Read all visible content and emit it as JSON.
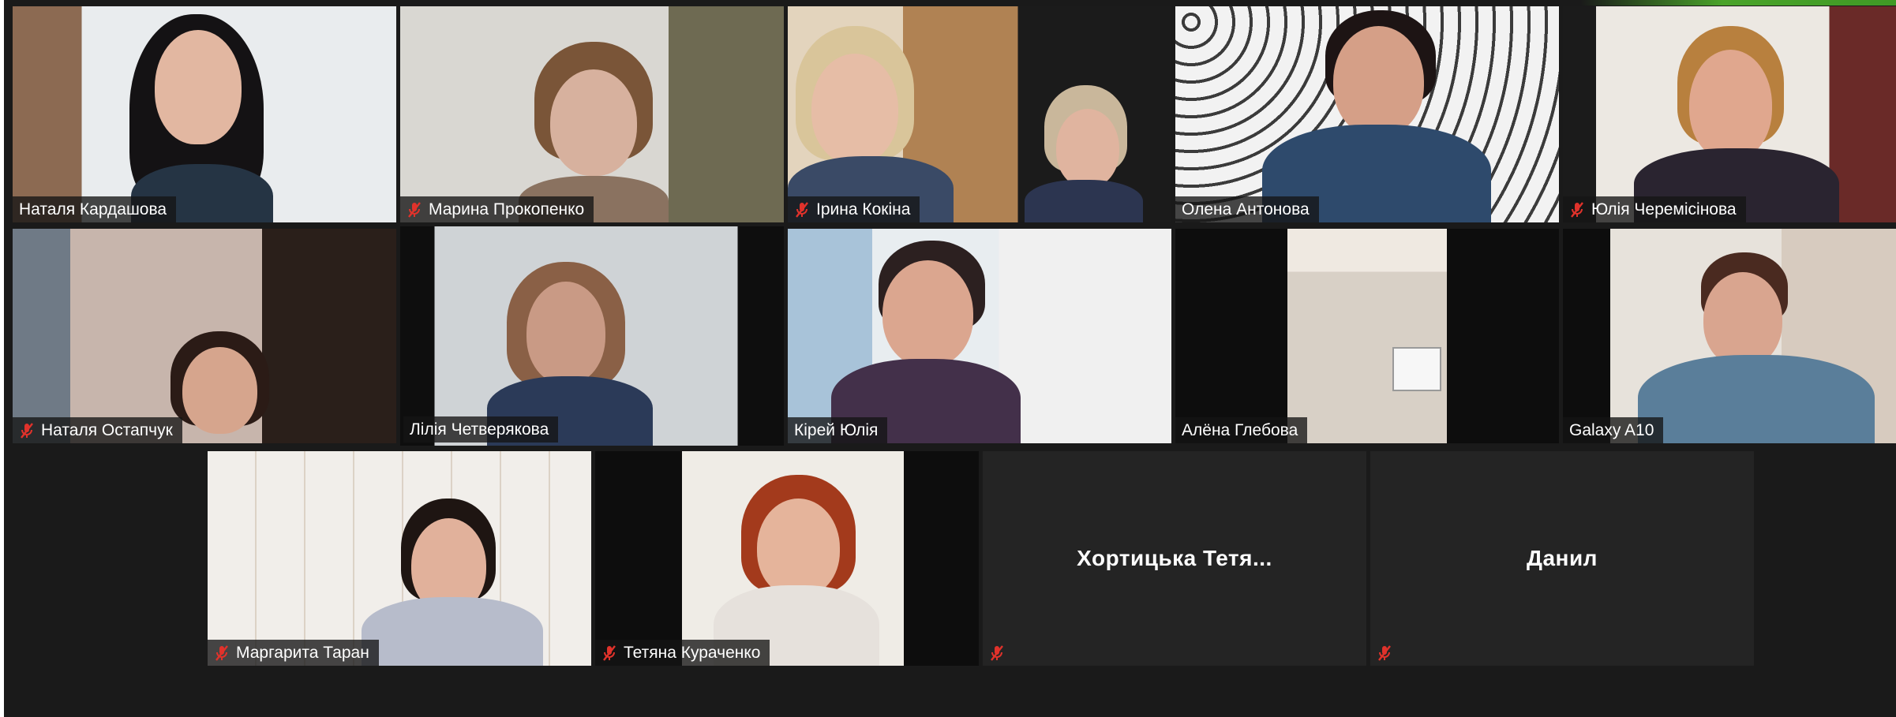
{
  "meeting": {
    "tiles": [
      {
        "name": "Наталя Кардашова",
        "muted": false
      },
      {
        "name": "Марина Прокопенко",
        "muted": true
      },
      {
        "name": "Ірина Кокіна",
        "muted": true
      },
      {
        "name": "Олена Антонова",
        "muted": false
      },
      {
        "name": "Юлія Черемісінова",
        "muted": true
      },
      {
        "name": "Наталя Остапчук",
        "muted": true
      },
      {
        "name": "Лілія Четверякова",
        "muted": false,
        "active_speaker": true
      },
      {
        "name": "Кірей Юлія",
        "muted": false
      },
      {
        "name": "Алёна Глебова",
        "muted": false
      },
      {
        "name": "Galaxy A10",
        "muted": false
      },
      {
        "name": "Маргарита Таран",
        "muted": true
      },
      {
        "name": "Тетяна Кураченко",
        "muted": true
      },
      {
        "name": "Хортицька Тетя...",
        "muted": true,
        "video_off": true
      },
      {
        "name": "Данил",
        "muted": true,
        "video_off": true
      }
    ]
  },
  "colors": {
    "active_speaker_border": "#c9e05a",
    "muted_icon": "#e0322b",
    "accent_corner": "#4aa32a"
  },
  "icons": {
    "muted": "microphone-muted-icon"
  }
}
